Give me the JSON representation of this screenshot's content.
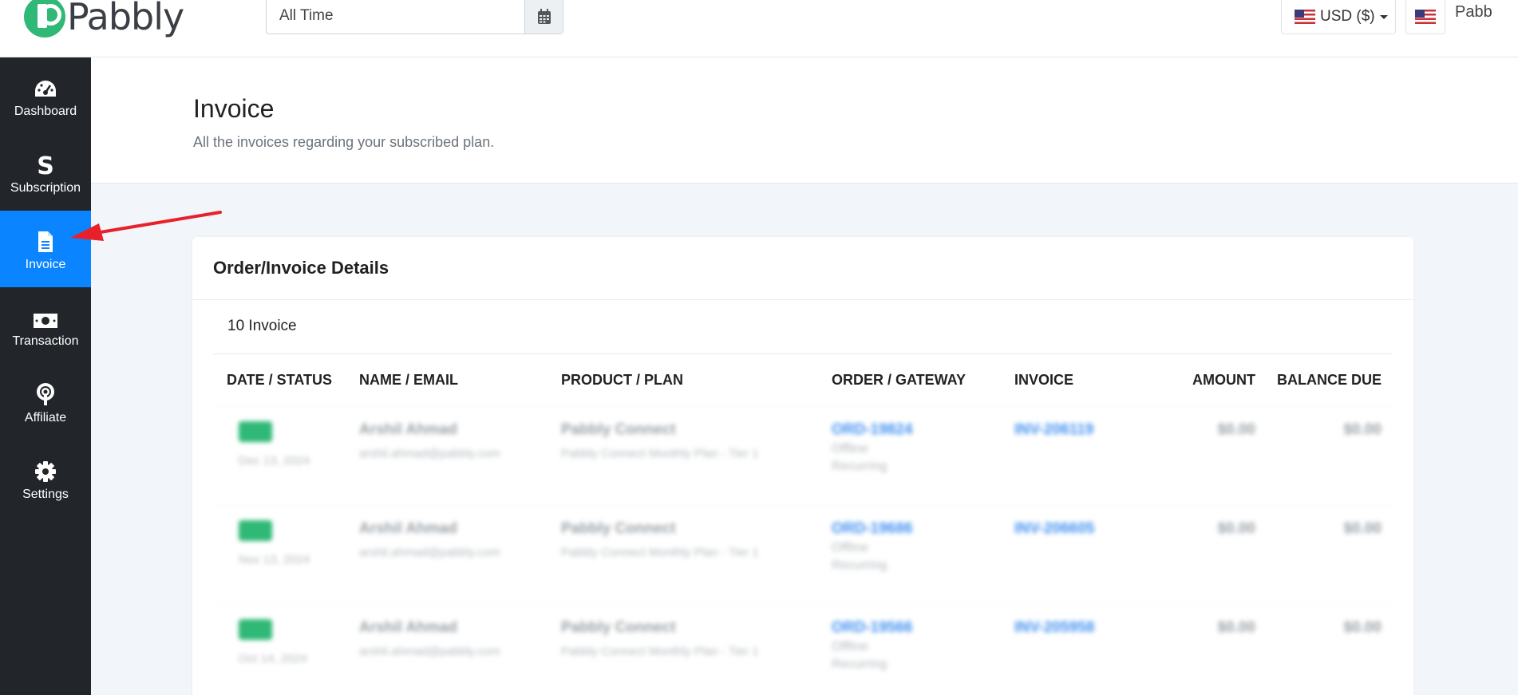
{
  "header": {
    "brand": "Pabbly",
    "date_filter": "All Time",
    "currency": "USD ($)",
    "user_name": "Pabb"
  },
  "sidebar": {
    "items": [
      {
        "label": "Dashboard",
        "icon": "dashboard-gauge-icon"
      },
      {
        "label": "Subscription",
        "icon": "dollar-s-icon"
      },
      {
        "label": "Invoice",
        "icon": "document-icon",
        "active": true
      },
      {
        "label": "Transaction",
        "icon": "money-bill-icon"
      },
      {
        "label": "Affiliate",
        "icon": "broadcast-icon"
      },
      {
        "label": "Settings",
        "icon": "gear-icon"
      }
    ]
  },
  "page": {
    "title": "Invoice",
    "subtitle": "All the invoices regarding your subscribed plan."
  },
  "card": {
    "title": "Order/Invoice Details",
    "count": "10 Invoice",
    "columns": [
      "DATE / STATUS",
      "NAME / EMAIL",
      "PRODUCT / PLAN",
      "ORDER / GATEWAY",
      "INVOICE",
      "AMOUNT",
      "BALANCE DUE"
    ],
    "rows": [
      {
        "status": "Paid",
        "date": "Dec 13, 2024",
        "name": "Arshil Ahmad",
        "email": "arshil.ahmad@pabbly.com",
        "product": "Pabbly Connect",
        "plan": "Pabbly Connect Monthly Plan - Tier 1",
        "order": "ORD-19824",
        "gateway": "Offline",
        "gateway_type": "Recurring",
        "invoice": "INV-206119",
        "amount": "$0.00",
        "balance": "$0.00"
      },
      {
        "status": "Paid",
        "date": "Nov 13, 2024",
        "name": "Arshil Ahmad",
        "email": "arshil.ahmad@pabbly.com",
        "product": "Pabbly Connect",
        "plan": "Pabbly Connect Monthly Plan - Tier 1",
        "order": "ORD-19686",
        "gateway": "Offline",
        "gateway_type": "Recurring",
        "invoice": "INV-206605",
        "amount": "$0.00",
        "balance": "$0.00"
      },
      {
        "status": "Paid",
        "date": "Oct 14, 2024",
        "name": "Arshil Ahmad",
        "email": "arshil.ahmad@pabbly.com",
        "product": "Pabbly Connect",
        "plan": "Pabbly Connect Monthly Plan - Tier 1",
        "order": "ORD-19566",
        "gateway": "Offline",
        "gateway_type": "Recurring",
        "invoice": "INV-205958",
        "amount": "$0.00",
        "balance": "$0.00"
      }
    ]
  },
  "colors": {
    "sidebar_bg": "#22262b",
    "active_blue": "#0a84ff",
    "brand_green": "#2fb876",
    "annotation_red": "#e8202a"
  }
}
